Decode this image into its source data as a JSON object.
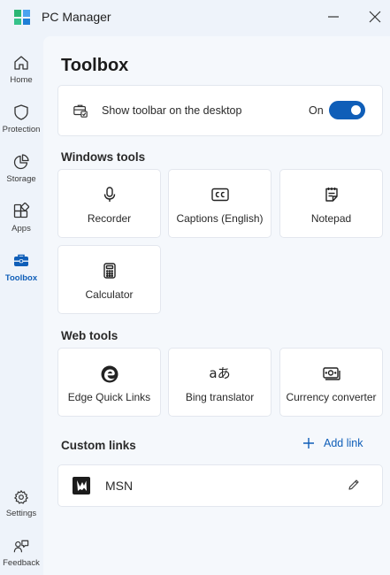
{
  "app": {
    "title": "PC Manager"
  },
  "sidebar": {
    "items": [
      {
        "label": "Home",
        "icon": "home-icon",
        "active": false
      },
      {
        "label": "Protection",
        "icon": "shield-icon",
        "active": false
      },
      {
        "label": "Storage",
        "icon": "pie-chart-icon",
        "active": false
      },
      {
        "label": "Apps",
        "icon": "apps-icon",
        "active": false
      },
      {
        "label": "Toolbox",
        "icon": "toolbox-icon",
        "active": true
      }
    ],
    "bottom_items": [
      {
        "label": "Settings",
        "icon": "gear-icon"
      },
      {
        "label": "Feedback",
        "icon": "feedback-icon"
      }
    ]
  },
  "main": {
    "title": "Toolbox",
    "toolbar_setting": {
      "label": "Show toolbar on the desktop",
      "state_label": "On",
      "enabled": true
    },
    "windows_tools": {
      "title": "Windows tools",
      "items": [
        {
          "label": "Recorder",
          "icon": "microphone-icon"
        },
        {
          "label": "Captions (English)",
          "icon": "captions-icon"
        },
        {
          "label": "Notepad",
          "icon": "notepad-icon"
        },
        {
          "label": "Calculator",
          "icon": "calculator-icon"
        }
      ]
    },
    "web_tools": {
      "title": "Web tools",
      "items": [
        {
          "label": "Edge Quick Links",
          "icon": "edge-icon"
        },
        {
          "label": "Bing translator",
          "icon": "translate-icon",
          "glyph": "aあ"
        },
        {
          "label": "Currency converter",
          "icon": "currency-icon"
        }
      ]
    },
    "custom_links": {
      "title": "Custom links",
      "add_label": "Add link",
      "items": [
        {
          "label": "MSN",
          "icon": "msn-logo"
        }
      ]
    }
  },
  "colors": {
    "accent": "#0f5eb8",
    "window_background": "#eef3fa",
    "content_background": "#f5f8fc",
    "card_background": "#ffffff",
    "card_border": "#e3e7ee"
  }
}
